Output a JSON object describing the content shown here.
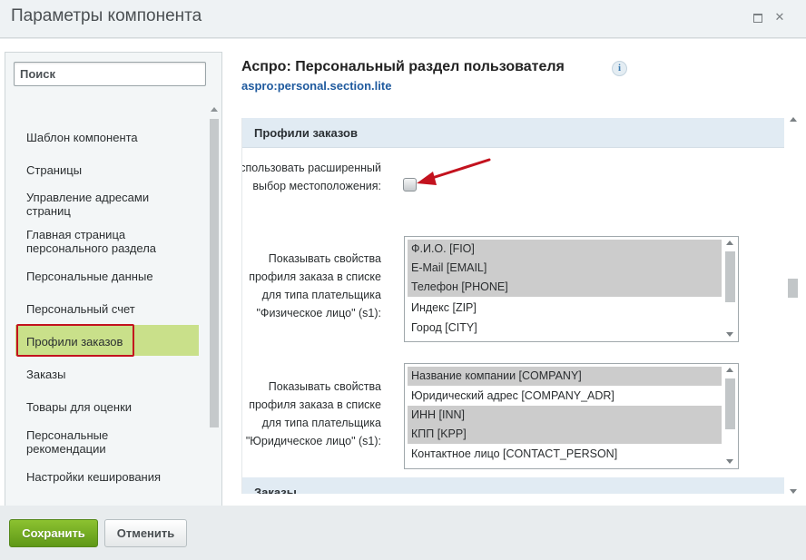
{
  "window": {
    "title": "Параметры компонента",
    "maximize_icon": "window-maximize-icon",
    "close_icon": "window-close-icon",
    "close_glyph": "✕"
  },
  "sidebar": {
    "search_placeholder": "Поиск",
    "active_index": 6,
    "items": [
      {
        "label": "Шаблон компонента"
      },
      {
        "label": "Страницы"
      },
      {
        "label": "Управление адресами страниц"
      },
      {
        "label": "Главная страница персонального раздела"
      },
      {
        "label": "Персональные данные"
      },
      {
        "label": "Персональный счет"
      },
      {
        "label": "Профили заказов"
      },
      {
        "label": "Заказы"
      },
      {
        "label": "Товары для оценки"
      },
      {
        "label": "Персональные рекомендации"
      },
      {
        "label": "Настройки кеширования"
      }
    ]
  },
  "component": {
    "title": "Аспро: Персональный раздел пользователя",
    "info_glyph": "i",
    "code": "aspro:personal.section.lite"
  },
  "section": {
    "title": "Профили заказов",
    "next_title": "Заказы"
  },
  "params": {
    "location_label": "Использовать расширенный выбор местоположения:",
    "location_checked": false,
    "individual_label": "Показывать свойства профиля заказа в списке для типа плательщика \"Физическое лицо\" (s1):",
    "individual_options": [
      {
        "label": "Ф.И.О. [FIO]",
        "selected": true
      },
      {
        "label": "E-Mail [EMAIL]",
        "selected": true
      },
      {
        "label": "Телефон [PHONE]",
        "selected": true
      },
      {
        "label": "Индекс [ZIP]",
        "selected": false
      },
      {
        "label": "Город [CITY]",
        "selected": false
      }
    ],
    "legal_label": "Показывать свойства профиля заказа в списке для типа плательщика \"Юридическое лицо\" (s1):",
    "legal_options": [
      {
        "label": "Название компании [COMPANY]",
        "selected": true
      },
      {
        "label": "Юридический адрес [COMPANY_ADR]",
        "selected": false
      },
      {
        "label": "ИНН [INN]",
        "selected": true
      },
      {
        "label": "КПП [KPP]",
        "selected": true
      },
      {
        "label": "Контактное лицо [CONTACT_PERSON]",
        "selected": false
      }
    ]
  },
  "annotation": {
    "arrow_color": "#c3121e",
    "highlight_color": "#c3121e"
  },
  "footer": {
    "save_label": "Сохранить",
    "cancel_label": "Отменить"
  },
  "colors": {
    "save_button": "#6aa81e",
    "active_item": "#c9e08a",
    "code_link": "#1f5a9e"
  }
}
